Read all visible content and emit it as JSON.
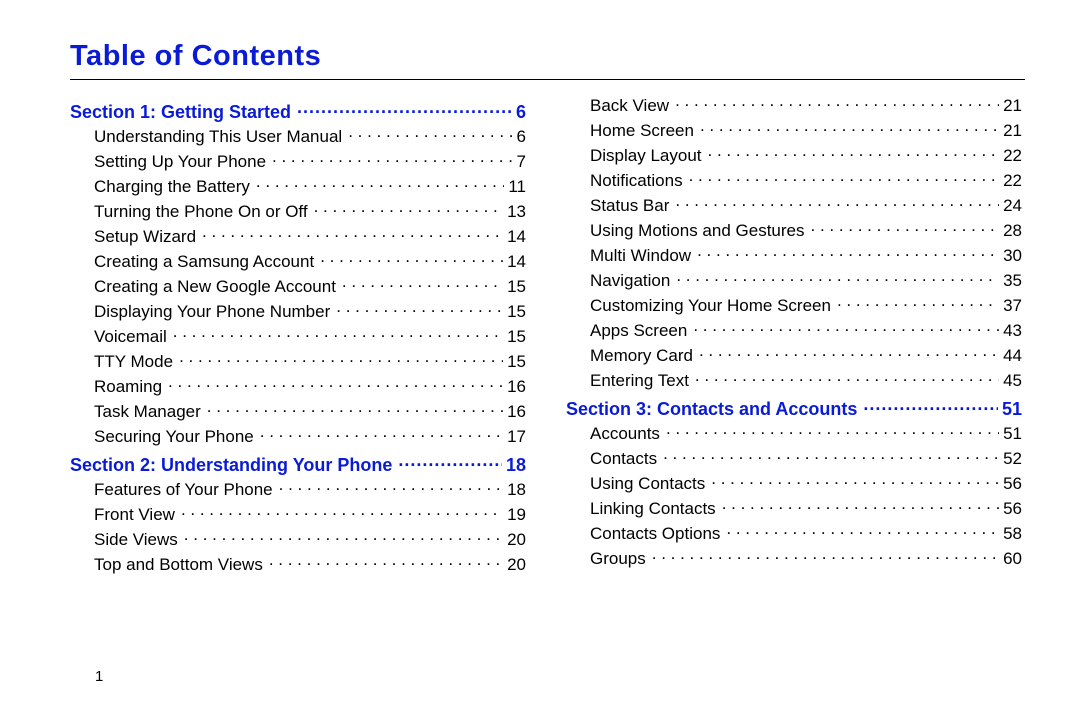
{
  "title": "Table of Contents",
  "footer_page": "1",
  "sections": [
    {
      "col": 0,
      "kind": "section",
      "label": "Section 1:  Getting Started",
      "page": "6"
    },
    {
      "col": 0,
      "kind": "entry",
      "label": "Understanding This User Manual",
      "page": "6"
    },
    {
      "col": 0,
      "kind": "entry",
      "label": "Setting Up Your Phone",
      "page": "7"
    },
    {
      "col": 0,
      "kind": "entry",
      "label": "Charging the Battery",
      "page": "11"
    },
    {
      "col": 0,
      "kind": "entry",
      "label": "Turning the Phone On or Off",
      "page": "13"
    },
    {
      "col": 0,
      "kind": "entry",
      "label": "Setup Wizard",
      "page": "14"
    },
    {
      "col": 0,
      "kind": "entry",
      "label": "Creating a Samsung Account",
      "page": "14"
    },
    {
      "col": 0,
      "kind": "entry",
      "label": "Creating a New Google Account",
      "page": "15"
    },
    {
      "col": 0,
      "kind": "entry",
      "label": "Displaying Your Phone Number",
      "page": "15"
    },
    {
      "col": 0,
      "kind": "entry",
      "label": "Voicemail",
      "page": "15"
    },
    {
      "col": 0,
      "kind": "entry",
      "label": "TTY Mode",
      "page": "15"
    },
    {
      "col": 0,
      "kind": "entry",
      "label": "Roaming",
      "page": "16"
    },
    {
      "col": 0,
      "kind": "entry",
      "label": "Task Manager",
      "page": "16"
    },
    {
      "col": 0,
      "kind": "entry",
      "label": "Securing Your Phone",
      "page": "17"
    },
    {
      "col": 0,
      "kind": "section",
      "label": "Section 2:  Understanding Your Phone",
      "page": "18"
    },
    {
      "col": 0,
      "kind": "entry",
      "label": "Features of Your Phone",
      "page": "18"
    },
    {
      "col": 0,
      "kind": "entry",
      "label": "Front View",
      "page": "19"
    },
    {
      "col": 0,
      "kind": "entry",
      "label": "Side Views",
      "page": "20"
    },
    {
      "col": 0,
      "kind": "entry",
      "label": "Top and Bottom Views",
      "page": "20"
    },
    {
      "col": 1,
      "kind": "entry",
      "label": "Back View",
      "page": "21"
    },
    {
      "col": 1,
      "kind": "entry",
      "label": "Home Screen",
      "page": "21"
    },
    {
      "col": 1,
      "kind": "entry",
      "label": "Display Layout",
      "page": "22"
    },
    {
      "col": 1,
      "kind": "entry",
      "label": "Notifications",
      "page": "22"
    },
    {
      "col": 1,
      "kind": "entry",
      "label": "Status Bar",
      "page": "24"
    },
    {
      "col": 1,
      "kind": "entry",
      "label": "Using Motions and Gestures",
      "page": "28"
    },
    {
      "col": 1,
      "kind": "entry",
      "label": "Multi Window",
      "page": "30"
    },
    {
      "col": 1,
      "kind": "entry",
      "label": "Navigation",
      "page": "35"
    },
    {
      "col": 1,
      "kind": "entry",
      "label": "Customizing Your Home Screen",
      "page": "37"
    },
    {
      "col": 1,
      "kind": "entry",
      "label": "Apps Screen",
      "page": "43"
    },
    {
      "col": 1,
      "kind": "entry",
      "label": "Memory Card",
      "page": "44"
    },
    {
      "col": 1,
      "kind": "entry",
      "label": "Entering Text",
      "page": "45"
    },
    {
      "col": 1,
      "kind": "section",
      "label": "Section 3:  Contacts and Accounts",
      "page": "51"
    },
    {
      "col": 1,
      "kind": "entry",
      "label": "Accounts",
      "page": "51"
    },
    {
      "col": 1,
      "kind": "entry",
      "label": "Contacts",
      "page": "52"
    },
    {
      "col": 1,
      "kind": "entry",
      "label": "Using Contacts",
      "page": "56"
    },
    {
      "col": 1,
      "kind": "entry",
      "label": "Linking Contacts",
      "page": "56"
    },
    {
      "col": 1,
      "kind": "entry",
      "label": "Contacts Options",
      "page": "58"
    },
    {
      "col": 1,
      "kind": "entry",
      "label": "Groups",
      "page": "60"
    }
  ]
}
